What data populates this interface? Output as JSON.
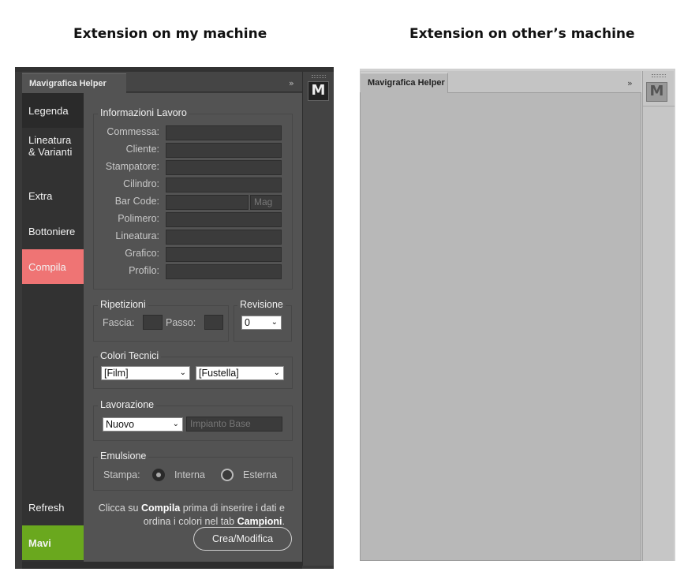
{
  "captions": {
    "left": "Extension on my machine",
    "right": "Extension on other’s machine"
  },
  "left_panel": {
    "tab_title": "Mavigrafica Helper",
    "collapse_glyph": "»",
    "dock_icon_letter": "M",
    "sidebar": {
      "items": [
        {
          "label": "Legenda"
        },
        {
          "label": "Lineatura\n& Varianti"
        },
        {
          "label": "Extra"
        },
        {
          "label": "Bottoniere"
        },
        {
          "label": "Compila"
        },
        {
          "label": "Refresh"
        },
        {
          "label": "Mavi"
        }
      ],
      "compila_color": "#ef7474",
      "mavi_color": "#6aa81e"
    },
    "informazioni": {
      "title": "Informazioni Lavoro",
      "fields": [
        {
          "label": "Commessa:",
          "value": ""
        },
        {
          "label": "Cliente:",
          "value": ""
        },
        {
          "label": "Stampatore:",
          "value": ""
        },
        {
          "label": "Cilindro:",
          "value": ""
        },
        {
          "label": "Bar Code:",
          "value": ""
        },
        {
          "label": "Polimero:",
          "value": ""
        },
        {
          "label": "Lineatura:",
          "value": ""
        },
        {
          "label": "Grafico:",
          "value": ""
        },
        {
          "label": "Profilo:",
          "value": ""
        }
      ],
      "barcode_mag_placeholder": "Mag"
    },
    "ripetizioni": {
      "title": "Ripetizioni",
      "fascia_label": "Fascia:",
      "passo_label": "Passo:"
    },
    "revisione": {
      "title": "Revisione",
      "selected": "0"
    },
    "colori_tecnici": {
      "title": "Colori Tecnici",
      "film_selected": "[Film]",
      "fustella_selected": "[Fustella]"
    },
    "lavorazione": {
      "title": "Lavorazione",
      "selected": "Nuovo",
      "impianto_placeholder": "Impianto Base"
    },
    "emulsione": {
      "title": "Emulsione",
      "stampa_label": "Stampa:",
      "option_interna": "Interna",
      "option_esterna": "Esterna",
      "selected": "Interna"
    },
    "info": {
      "part1": "Clicca su ",
      "bold1": "Compila",
      "part2": " prima di inserire i dati e ordina i colori nel tab ",
      "bold2": "Campioni",
      "part3": "."
    },
    "crea_button": "Crea/Modifica"
  },
  "right_panel": {
    "tab_title": "Mavigrafica Helper",
    "collapse_glyph": "»",
    "dock_icon_letter": "M"
  }
}
